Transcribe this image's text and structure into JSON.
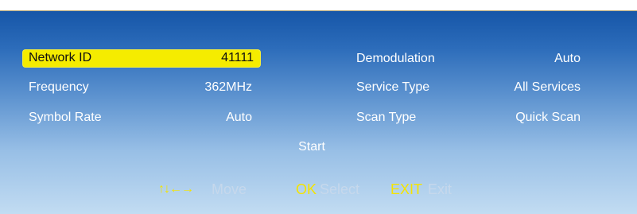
{
  "left_panel": {
    "rows": [
      {
        "label": "Network ID",
        "value": "41111"
      },
      {
        "label": "Frequency",
        "value": "362MHz"
      },
      {
        "label": "Symbol Rate",
        "value": "Auto"
      }
    ]
  },
  "right_panel": {
    "rows": [
      {
        "label": "Demodulation",
        "value": "Auto"
      },
      {
        "label": "Service Type",
        "value": "All Services"
      },
      {
        "label": "Scan Type",
        "value": "Quick Scan"
      }
    ]
  },
  "start_label": "Start",
  "hints": {
    "move_icon": "↑↓←→",
    "move_label": "Move",
    "ok_key": "OK",
    "ok_label": "Select",
    "exit_key": "EXIT",
    "exit_label": "Exit"
  },
  "colors": {
    "highlight": "#f5ec00",
    "key_yellow": "#f5e400",
    "hint_grey": "#c6d8ec"
  }
}
